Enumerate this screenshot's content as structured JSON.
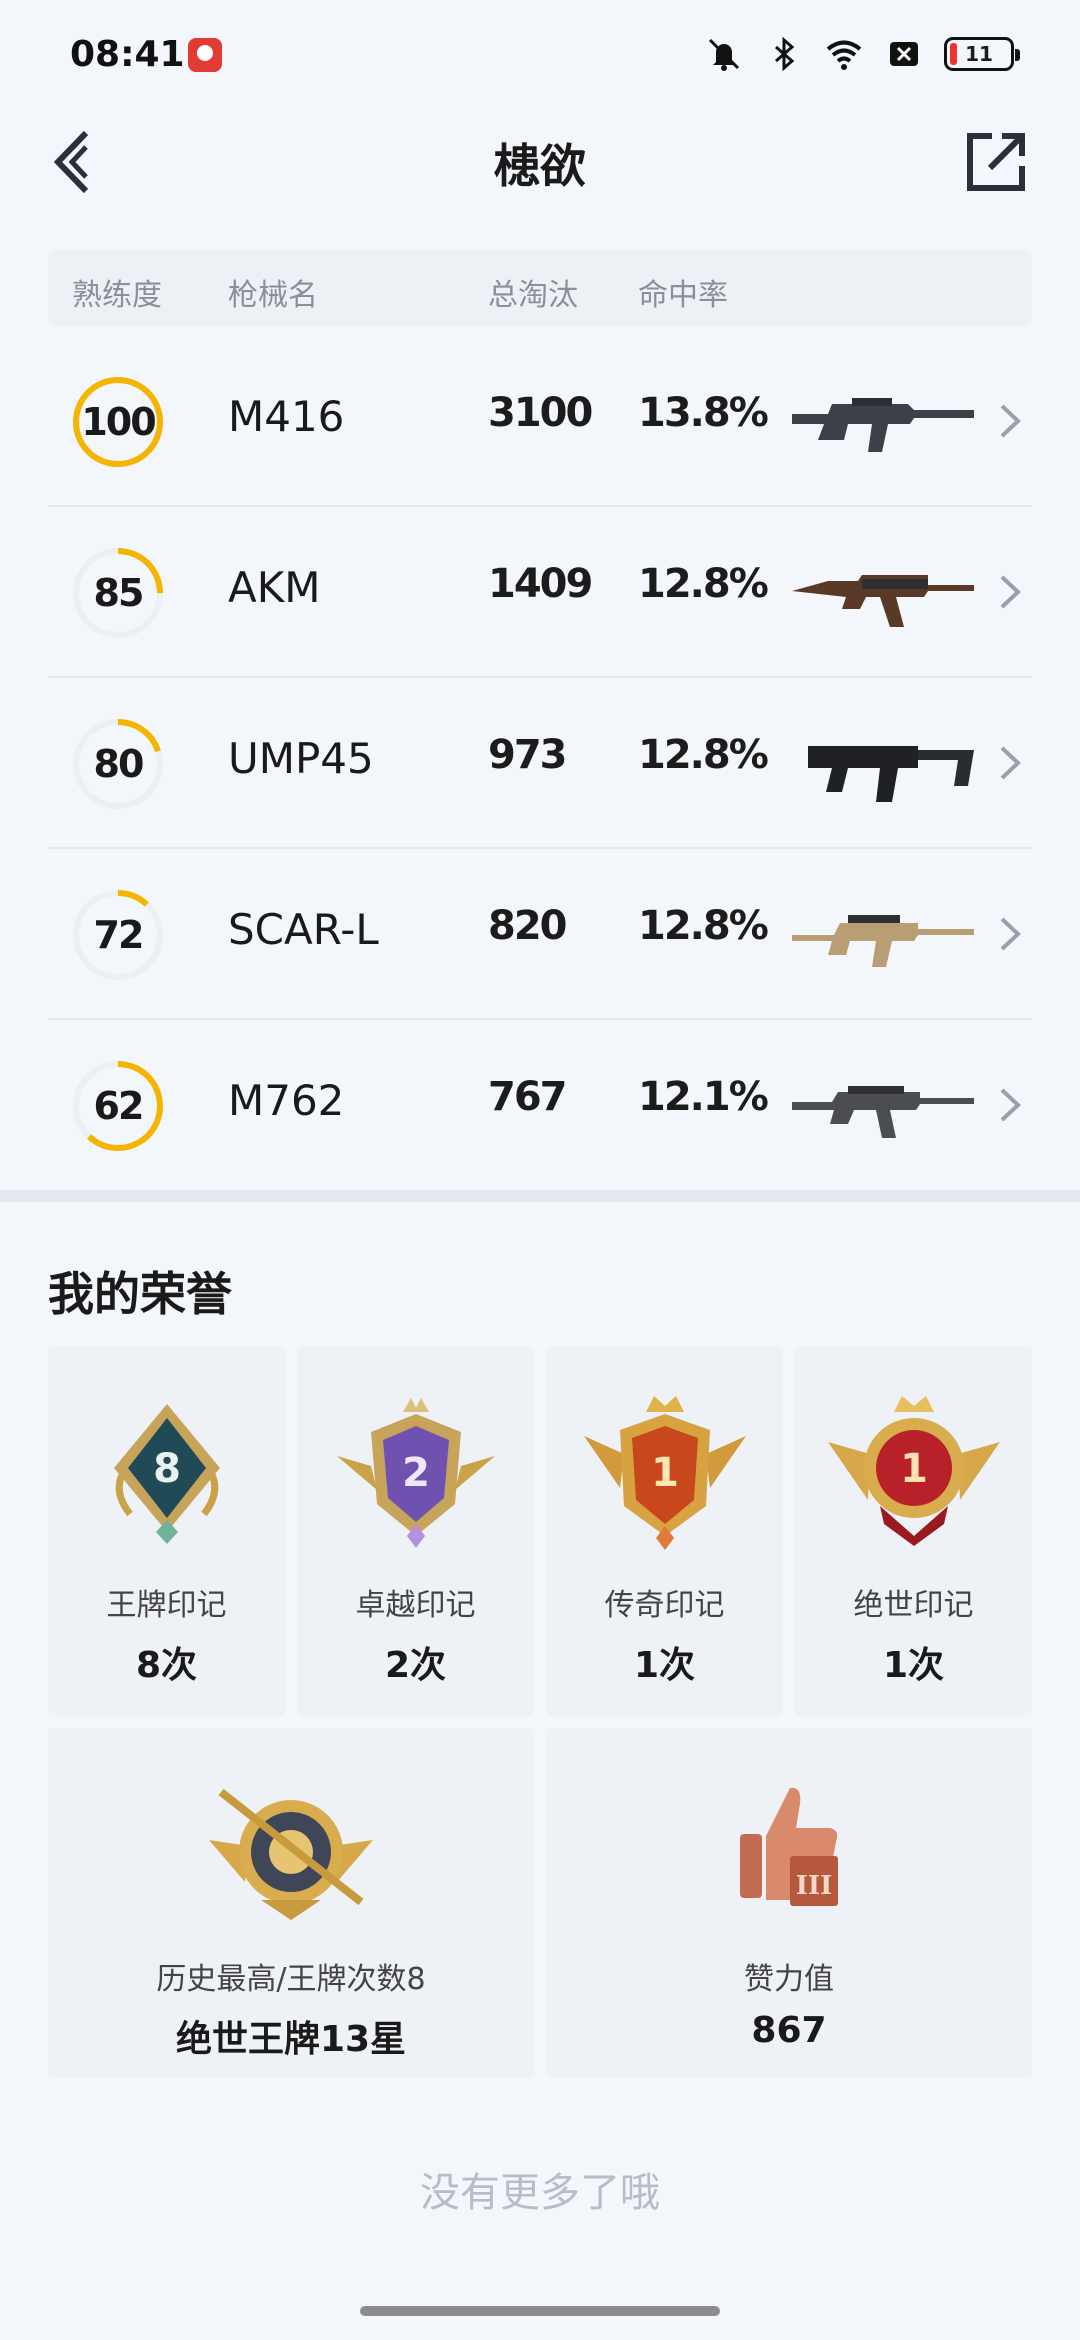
{
  "status": {
    "time": "08:41",
    "battery": "11",
    "icons": [
      "app-icon",
      "mute-icon",
      "bluetooth-icon",
      "wifi-icon",
      "close-box-icon",
      "battery-icon"
    ]
  },
  "header": {
    "title": "槵欲",
    "back_icon": "chevron-left-icon",
    "share_icon": "share-external-icon"
  },
  "table": {
    "columns": [
      "熟练度",
      "枪械名",
      "总淘汰",
      "命中率"
    ],
    "rows": [
      {
        "proficiency": "100",
        "progress": 1.0,
        "name": "M416",
        "kills": "3100",
        "accuracy": "13.8%",
        "image": "m416-rifle-image"
      },
      {
        "proficiency": "85",
        "progress": 0.25,
        "name": "AKM",
        "kills": "1409",
        "accuracy": "12.8%",
        "image": "akm-rifle-image"
      },
      {
        "proficiency": "80",
        "progress": 0.2,
        "name": "UMP45",
        "kills": "973",
        "accuracy": "12.8%",
        "image": "ump45-smg-image"
      },
      {
        "proficiency": "72",
        "progress": 0.12,
        "name": "SCAR-L",
        "kills": "820",
        "accuracy": "12.8%",
        "image": "scar-l-rifle-image"
      },
      {
        "proficiency": "62",
        "progress": 0.62,
        "name": "M762",
        "kills": "767",
        "accuracy": "12.1%",
        "image": "m762-rifle-image"
      }
    ]
  },
  "honors": {
    "title": "我的荣誉",
    "badges": [
      {
        "label": "王牌印记",
        "count": "8次",
        "badge_number": "8",
        "icon": "ace-badge-icon"
      },
      {
        "label": "卓越印记",
        "count": "2次",
        "badge_number": "2",
        "icon": "excellence-badge-icon"
      },
      {
        "label": "传奇印记",
        "count": "1次",
        "badge_number": "1",
        "icon": "legend-badge-icon"
      },
      {
        "label": "绝世印记",
        "count": "1次",
        "badge_number": "1",
        "icon": "peerless-badge-icon"
      }
    ],
    "highest": {
      "label": "历史最高/王牌次数8",
      "value": "绝世王牌13星",
      "icon": "rank-crest-icon"
    },
    "likes": {
      "label": "赞力值",
      "value": "867",
      "icon": "thumbs-up-icon",
      "roman": "III"
    }
  },
  "footer": {
    "no_more": "没有更多了哦"
  },
  "colors": {
    "accent": "#f5b400",
    "background": "#f3f6fa",
    "card": "#eef1f6"
  }
}
